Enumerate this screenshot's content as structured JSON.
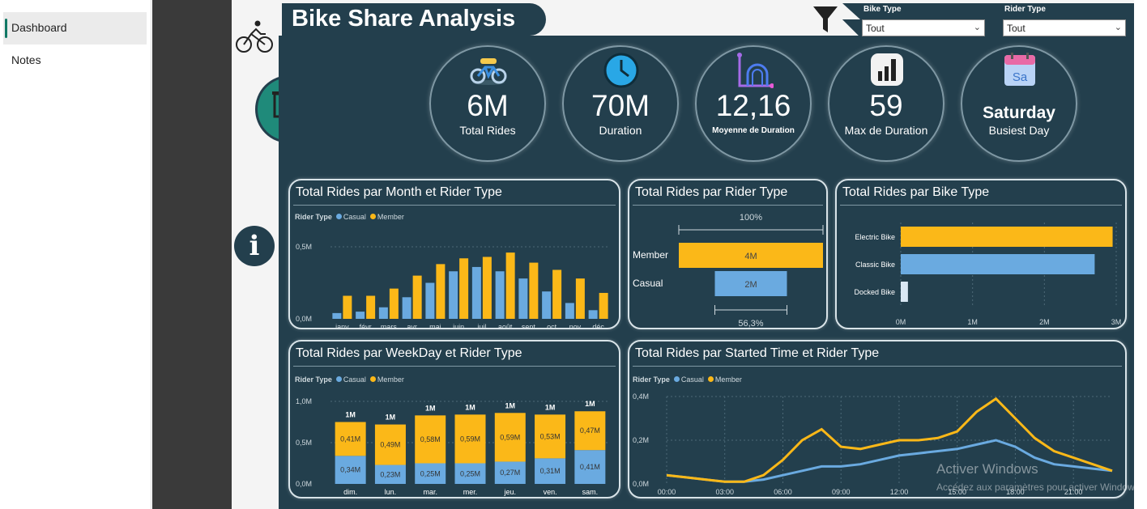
{
  "nav": {
    "items": [
      {
        "label": "Dashboard"
      },
      {
        "label": "Notes"
      }
    ]
  },
  "report": {
    "title": "Bike Share Analysis",
    "slicers": {
      "bike_type": {
        "label": "Bike Type",
        "value": "Tout"
      },
      "rider_type": {
        "label": "Rider Type",
        "value": "Tout"
      }
    },
    "icons": [
      "bike-icon",
      "presentation-icon",
      "info-icon",
      "filter-icon"
    ]
  },
  "kpis": [
    {
      "value": "6M",
      "label": "Total Rides",
      "icon": "bicycle-icon"
    },
    {
      "value": "70M",
      "label": "Duration",
      "icon": "clock-icon"
    },
    {
      "value": "12,16",
      "label": "Moyenne de Duration",
      "icon": "graph-icon"
    },
    {
      "value": "59",
      "label": "Max de Duration",
      "icon": "bar-chart-icon"
    },
    {
      "value": "Saturday",
      "label": "Busiest Day",
      "icon": "calendar-icon"
    }
  ],
  "colors": {
    "casual": "#6aaae0",
    "member": "#fbb818",
    "bg": "#233f4d"
  },
  "legend": {
    "title": "Rider Type",
    "casual": "Casual",
    "member": "Member"
  },
  "chart_data": [
    {
      "type": "bar",
      "title": "Total Rides par Month et Rider Type",
      "categories": [
        "janv",
        "févr",
        "mars",
        "avr",
        "mai",
        "juin",
        "juil",
        "août",
        "sept",
        "oct",
        "nov",
        "déc"
      ],
      "series": [
        {
          "name": "Casual",
          "values": [
            0.04,
            0.05,
            0.08,
            0.15,
            0.25,
            0.33,
            0.36,
            0.33,
            0.28,
            0.19,
            0.11,
            0.06
          ]
        },
        {
          "name": "Member",
          "values": [
            0.16,
            0.16,
            0.21,
            0.3,
            0.38,
            0.42,
            0.43,
            0.46,
            0.39,
            0.34,
            0.28,
            0.18
          ]
        }
      ],
      "yticks": [
        "0,0M",
        "0,5M"
      ],
      "ylim": [
        0,
        0.5
      ]
    },
    {
      "type": "bar",
      "title": "Total Rides par Rider Type",
      "categories": [
        "Member",
        "Casual"
      ],
      "values": [
        4,
        2
      ],
      "value_labels": [
        "4M",
        "2M"
      ],
      "annotations": [
        "100%",
        "56,3%"
      ]
    },
    {
      "type": "bar",
      "title": "Total Rides par Bike Type",
      "categories": [
        "Electric Bike",
        "Classic Bike",
        "Docked Bike"
      ],
      "values": [
        2.95,
        2.7,
        0.1
      ],
      "xticks": [
        "0M",
        "1M",
        "2M",
        "3M"
      ],
      "xlim": [
        0,
        3
      ]
    },
    {
      "type": "bar",
      "title": "Total Rides par WeekDay et Rider Type",
      "categories": [
        "dim.",
        "lun.",
        "mar.",
        "mer.",
        "jeu.",
        "ven.",
        "sam."
      ],
      "series": [
        {
          "name": "Casual",
          "values": [
            0.34,
            0.23,
            0.25,
            0.25,
            0.27,
            0.31,
            0.41
          ],
          "labels": [
            "0,34M",
            "0,23M",
            "0,25M",
            "0,25M",
            "0,27M",
            "0,31M",
            "0,41M"
          ]
        },
        {
          "name": "Member",
          "values": [
            0.41,
            0.49,
            0.58,
            0.59,
            0.59,
            0.53,
            0.47
          ],
          "labels": [
            "0,41M",
            "0,49M",
            "0,58M",
            "0,59M",
            "0,59M",
            "0,53M",
            "0,47M"
          ]
        }
      ],
      "totals": [
        "1M",
        "1M",
        "1M",
        "1M",
        "1M",
        "1M",
        "1M"
      ],
      "yticks": [
        "0,0M",
        "0,5M",
        "1,0M"
      ],
      "ylim": [
        0,
        1.0
      ]
    },
    {
      "type": "line",
      "title": "Total Rides par Started Time et Rider Type",
      "x": [
        0,
        1,
        2,
        3,
        4,
        5,
        6,
        7,
        8,
        9,
        10,
        11,
        12,
        13,
        14,
        15,
        16,
        17,
        18,
        19,
        20,
        21,
        22,
        23
      ],
      "series": [
        {
          "name": "Casual",
          "values": [
            0.04,
            0.03,
            0.02,
            0.01,
            0.01,
            0.02,
            0.04,
            0.06,
            0.08,
            0.08,
            0.09,
            0.11,
            0.13,
            0.14,
            0.15,
            0.16,
            0.18,
            0.2,
            0.17,
            0.12,
            0.09,
            0.08,
            0.07,
            0.06
          ]
        },
        {
          "name": "Member",
          "values": [
            0.04,
            0.03,
            0.02,
            0.01,
            0.01,
            0.04,
            0.11,
            0.2,
            0.25,
            0.17,
            0.16,
            0.18,
            0.2,
            0.2,
            0.21,
            0.24,
            0.33,
            0.39,
            0.3,
            0.21,
            0.15,
            0.12,
            0.09,
            0.06
          ]
        }
      ],
      "xticks": [
        "00:00",
        "03:00",
        "06:00",
        "09:00",
        "12:00",
        "15:00",
        "18:00",
        "21:00"
      ],
      "yticks": [
        "0,0M",
        "0,2M",
        "0,4M"
      ],
      "ylim": [
        0,
        0.4
      ]
    }
  ],
  "watermark": {
    "line1": "Activer Windows",
    "line2": "Accédez aux paramètres pour activer Windows."
  }
}
